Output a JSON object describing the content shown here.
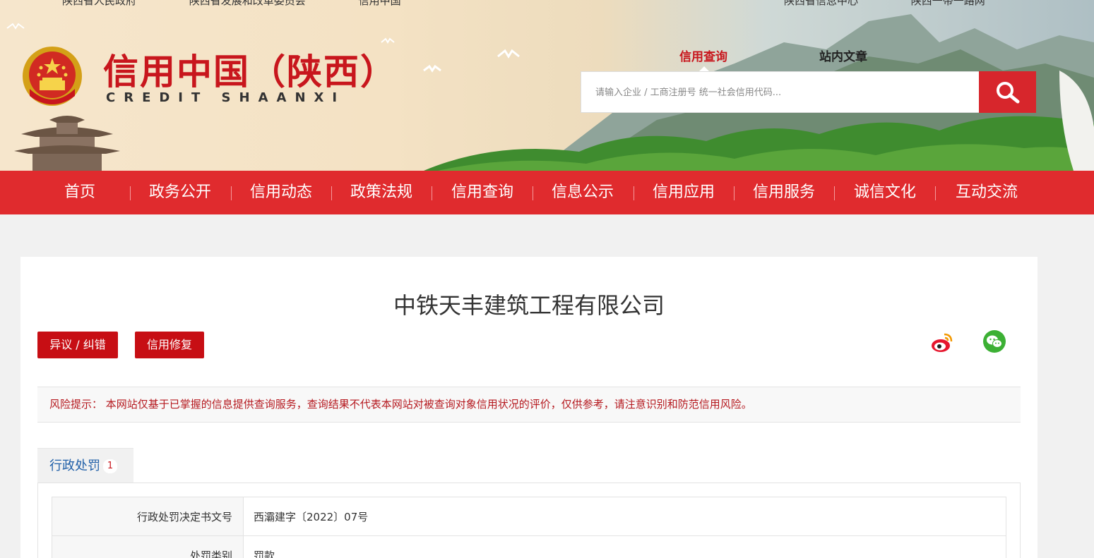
{
  "top_links": {
    "left": [
      "陕西省人民政府",
      "陕西省发展和改革委员会",
      "信用中国"
    ],
    "right": [
      "陕西省信息中心",
      "陕西一带一路网"
    ]
  },
  "logo": {
    "title": "信用中国（陕西）",
    "subtitle": "CREDIT    SHAANXI"
  },
  "search": {
    "tab_credit": "信用查询",
    "tab_article": "站内文章",
    "placeholder": "请输入企业 / 工商注册号 统一社会信用代码..."
  },
  "nav": {
    "items": [
      "首页",
      "政务公开",
      "信用动态",
      "政策法规",
      "信用查询",
      "信息公示",
      "信用应用",
      "信用服务",
      "诚信文化",
      "互动交流"
    ]
  },
  "company": {
    "name": "中铁天丰建筑工程有限公司"
  },
  "actions": {
    "objection_label": "异议 / 纠错",
    "repair_label": "信用修复"
  },
  "risk": {
    "text": "风险提示： 本网站仅基于已掌握的信息提供查询服务，查询结果不代表本网站对被查询对象信用状况的评价，仅供参考，请注意识别和防范信用风险。"
  },
  "tabs": {
    "penalty_label": "行政处罚",
    "penalty_count": "1"
  },
  "penalty_table": {
    "rows": [
      {
        "key": "行政处罚决定书文号",
        "value": "西灞建字〔2022〕07号"
      },
      {
        "key": "处罚类别",
        "value": "罚款"
      }
    ]
  },
  "colors": {
    "brand_red": "#c8161d",
    "nav_red": "#e02b2e",
    "button_red": "#c70e14",
    "link_blue": "#1f5fa8"
  }
}
